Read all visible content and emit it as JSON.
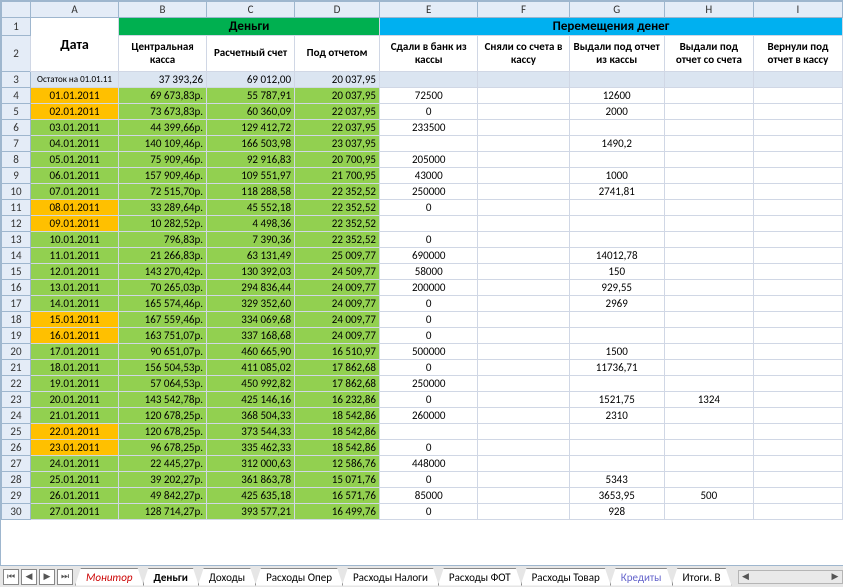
{
  "columns": [
    "",
    "A",
    "B",
    "C",
    "D",
    "E",
    "F",
    "G",
    "H",
    "I"
  ],
  "header_groups": {
    "money": "Деньги",
    "move": "Перемещения денег"
  },
  "col_labels": {
    "date": "Дата",
    "B": "Центральная касса",
    "C": "Расчетный счет",
    "D": "Под отчетом",
    "E": "Сдали в банк из кассы",
    "F": "Сняли со счета в кассу",
    "G": "Выдали под отчет из кассы",
    "H": "Выдали под отчет со счета",
    "I": "Вернули под отчет в кассу"
  },
  "ost_label": "Остаток на 01.01.11",
  "ost": {
    "B": "37 393,26",
    "C": "69 012,00",
    "D": "20 037,95"
  },
  "rows": [
    {
      "n": 4,
      "date": "01.01.2011",
      "hl": true,
      "B": "69 673,83р.",
      "C": "55 787,91",
      "D": "20 037,95",
      "E": "72500",
      "G": "12600"
    },
    {
      "n": 5,
      "date": "02.01.2011",
      "hl": true,
      "B": "73 673,83р.",
      "C": "60 360,09",
      "D": "22 037,95",
      "E": "0",
      "G": "2000"
    },
    {
      "n": 6,
      "date": "03.01.2011",
      "B": "44 399,66р.",
      "C": "129 412,72",
      "D": "22 037,95",
      "E": "233500"
    },
    {
      "n": 7,
      "date": "04.01.2011",
      "B": "140 109,46р.",
      "C": "166 503,98",
      "D": "23 037,95",
      "E": "",
      "G": "1490,2"
    },
    {
      "n": 8,
      "date": "05.01.2011",
      "B": "75 909,46р.",
      "C": "92 916,83",
      "D": "20 700,95",
      "E": "205000"
    },
    {
      "n": 9,
      "date": "06.01.2011",
      "B": "157 909,46р.",
      "C": "109 551,97",
      "D": "21 700,95",
      "E": "43000",
      "G": "1000"
    },
    {
      "n": 10,
      "date": "07.01.2011",
      "B": "72 515,70р.",
      "C": "118 288,58",
      "D": "22 352,52",
      "E": "250000",
      "G": "2741,81"
    },
    {
      "n": 11,
      "date": "08.01.2011",
      "hl": true,
      "B": "33 289,64р.",
      "C": "45 552,18",
      "D": "22 352,52",
      "E": "0"
    },
    {
      "n": 12,
      "date": "09.01.2011",
      "hl": true,
      "B": "10 282,52р.",
      "C": "4 498,36",
      "D": "22 352,52"
    },
    {
      "n": 13,
      "date": "10.01.2011",
      "B": "796,83р.",
      "C": "7 390,36",
      "D": "22 352,52",
      "E": "0"
    },
    {
      "n": 14,
      "date": "11.01.2011",
      "B": "21 266,83р.",
      "C": "63 131,49",
      "D": "25 009,77",
      "E": "690000",
      "G": "14012,78"
    },
    {
      "n": 15,
      "date": "12.01.2011",
      "B": "143 270,42р.",
      "C": "130 392,03",
      "D": "24 509,77",
      "E": "58000",
      "G": "150"
    },
    {
      "n": 16,
      "date": "13.01.2011",
      "B": "70 265,03р.",
      "C": "294 836,44",
      "D": "24 009,77",
      "E": "200000",
      "G": "929,55"
    },
    {
      "n": 17,
      "date": "14.01.2011",
      "B": "165 574,46р.",
      "C": "329 352,60",
      "D": "24 009,77",
      "E": "0",
      "G": "2969"
    },
    {
      "n": 18,
      "date": "15.01.2011",
      "hl": true,
      "B": "167 559,46р.",
      "C": "334 069,68",
      "D": "24 009,77",
      "E": "0"
    },
    {
      "n": 19,
      "date": "16.01.2011",
      "hl": true,
      "B": "163 751,07р.",
      "C": "337 168,68",
      "D": "24 009,77",
      "E": "0"
    },
    {
      "n": 20,
      "date": "17.01.2011",
      "B": "90 651,07р.",
      "C": "460 665,90",
      "D": "16 510,97",
      "E": "500000",
      "G": "1500"
    },
    {
      "n": 21,
      "date": "18.01.2011",
      "B": "156 504,53р.",
      "C": "411 085,02",
      "D": "17 862,68",
      "E": "0",
      "G": "11736,71"
    },
    {
      "n": 22,
      "date": "19.01.2011",
      "B": "57 064,53р.",
      "C": "450 992,82",
      "D": "17 862,68",
      "E": "250000"
    },
    {
      "n": 23,
      "date": "20.01.2011",
      "B": "143 542,78р.",
      "C": "425 146,16",
      "D": "16 232,86",
      "E": "0",
      "G": "1521,75",
      "H": "1324"
    },
    {
      "n": 24,
      "date": "21.01.2011",
      "B": "120 678,25р.",
      "C": "368 504,33",
      "D": "18 542,86",
      "E": "260000",
      "G": "2310"
    },
    {
      "n": 25,
      "date": "22.01.2011",
      "hl": true,
      "B": "120 678,25р.",
      "C": "373 544,33",
      "D": "18 542,86"
    },
    {
      "n": 26,
      "date": "23.01.2011",
      "hl": true,
      "B": "96 678,25р.",
      "C": "335 462,33",
      "D": "18 542,86",
      "E": "0"
    },
    {
      "n": 27,
      "date": "24.01.2011",
      "B": "22 445,27р.",
      "C": "312 000,63",
      "D": "12 586,76",
      "E": "448000"
    },
    {
      "n": 28,
      "date": "25.01.2011",
      "B": "39 202,27р.",
      "C": "361 863,78",
      "D": "15 071,76",
      "E": "0",
      "G": "5343"
    },
    {
      "n": 29,
      "date": "26.01.2011",
      "B": "49 842,27р.",
      "C": "425 635,18",
      "D": "16 571,76",
      "E": "85000",
      "G": "3653,95",
      "H": "500"
    },
    {
      "n": 30,
      "date": "27.01.2011",
      "B": "128 714,27р.",
      "C": "393 577,21",
      "D": "16 499,76",
      "E": "0",
      "G": "928"
    }
  ],
  "tabs": [
    "Монитор",
    "Деньги",
    "Доходы",
    "Расходы Опер",
    "Расходы Налоги",
    "Расходы ФОТ",
    "Расходы Товар",
    "Кредиты",
    "Итоги. В"
  ],
  "active_tab": "Деньги"
}
